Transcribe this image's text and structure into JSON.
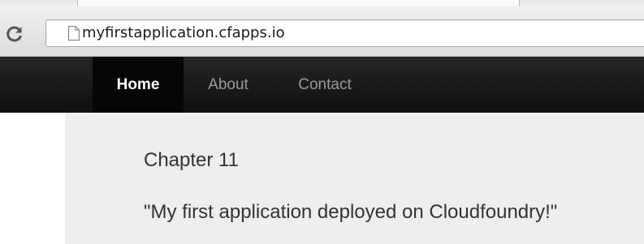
{
  "browser": {
    "url": "myfirstapplication.cfapps.io",
    "reload_icon": "reload-icon",
    "page_icon": "page-icon"
  },
  "navbar": {
    "items": [
      {
        "label": "Home",
        "active": true
      },
      {
        "label": "About",
        "active": false
      },
      {
        "label": "Contact",
        "active": false
      }
    ]
  },
  "main": {
    "heading": "Chapter 11",
    "message": "\"My first application deployed on Cloudfoundry!\""
  },
  "colors": {
    "navbar_bg": "#151515",
    "active_nav_bg": "#060606",
    "content_bg": "#eeeeee",
    "text": "#333333"
  }
}
